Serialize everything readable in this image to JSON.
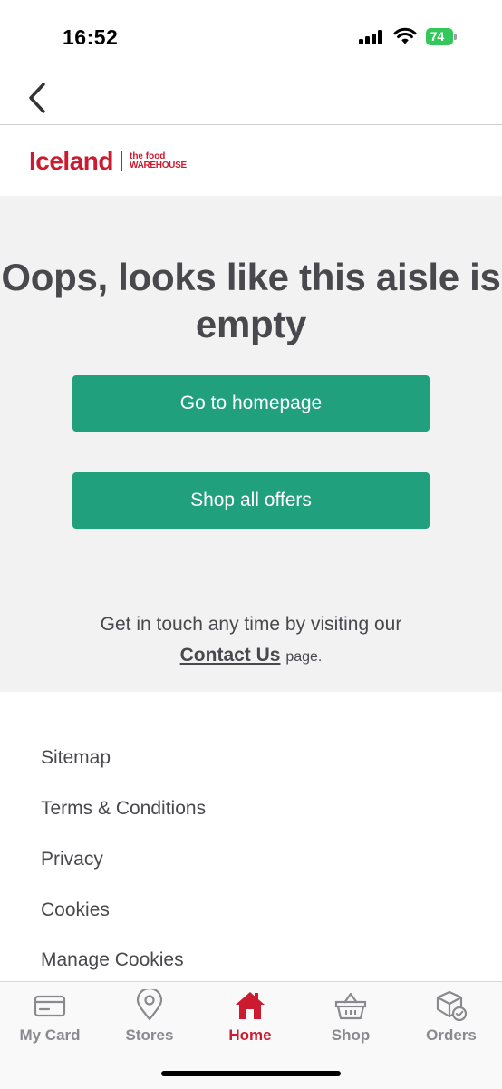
{
  "status_bar": {
    "time": "16:52",
    "battery": "74"
  },
  "header": {
    "logo_main": "Iceland",
    "logo_sub_line1": "the food",
    "logo_sub_line2": "WAREHOUSE",
    "brand_color": "#cc1a2e"
  },
  "main": {
    "title": "Oops, looks like this aisle is empty",
    "primary_button": "Go to homepage",
    "secondary_button": "Shop all offers",
    "contact_prefix": "Get in touch any time by visiting our",
    "contact_link": "Contact Us",
    "contact_suffix": "page.",
    "button_color": "#21a07d"
  },
  "footer": {
    "links": [
      "Sitemap",
      "Terms & Conditions",
      "Privacy",
      "Cookies",
      "Manage Cookies"
    ]
  },
  "tab_bar": {
    "tabs": [
      {
        "label": "My Card",
        "icon": "card-icon"
      },
      {
        "label": "Stores",
        "icon": "location-pin-icon"
      },
      {
        "label": "Home",
        "icon": "home-icon",
        "active": true
      },
      {
        "label": "Shop",
        "icon": "basket-icon"
      },
      {
        "label": "Orders",
        "icon": "package-check-icon"
      }
    ]
  }
}
